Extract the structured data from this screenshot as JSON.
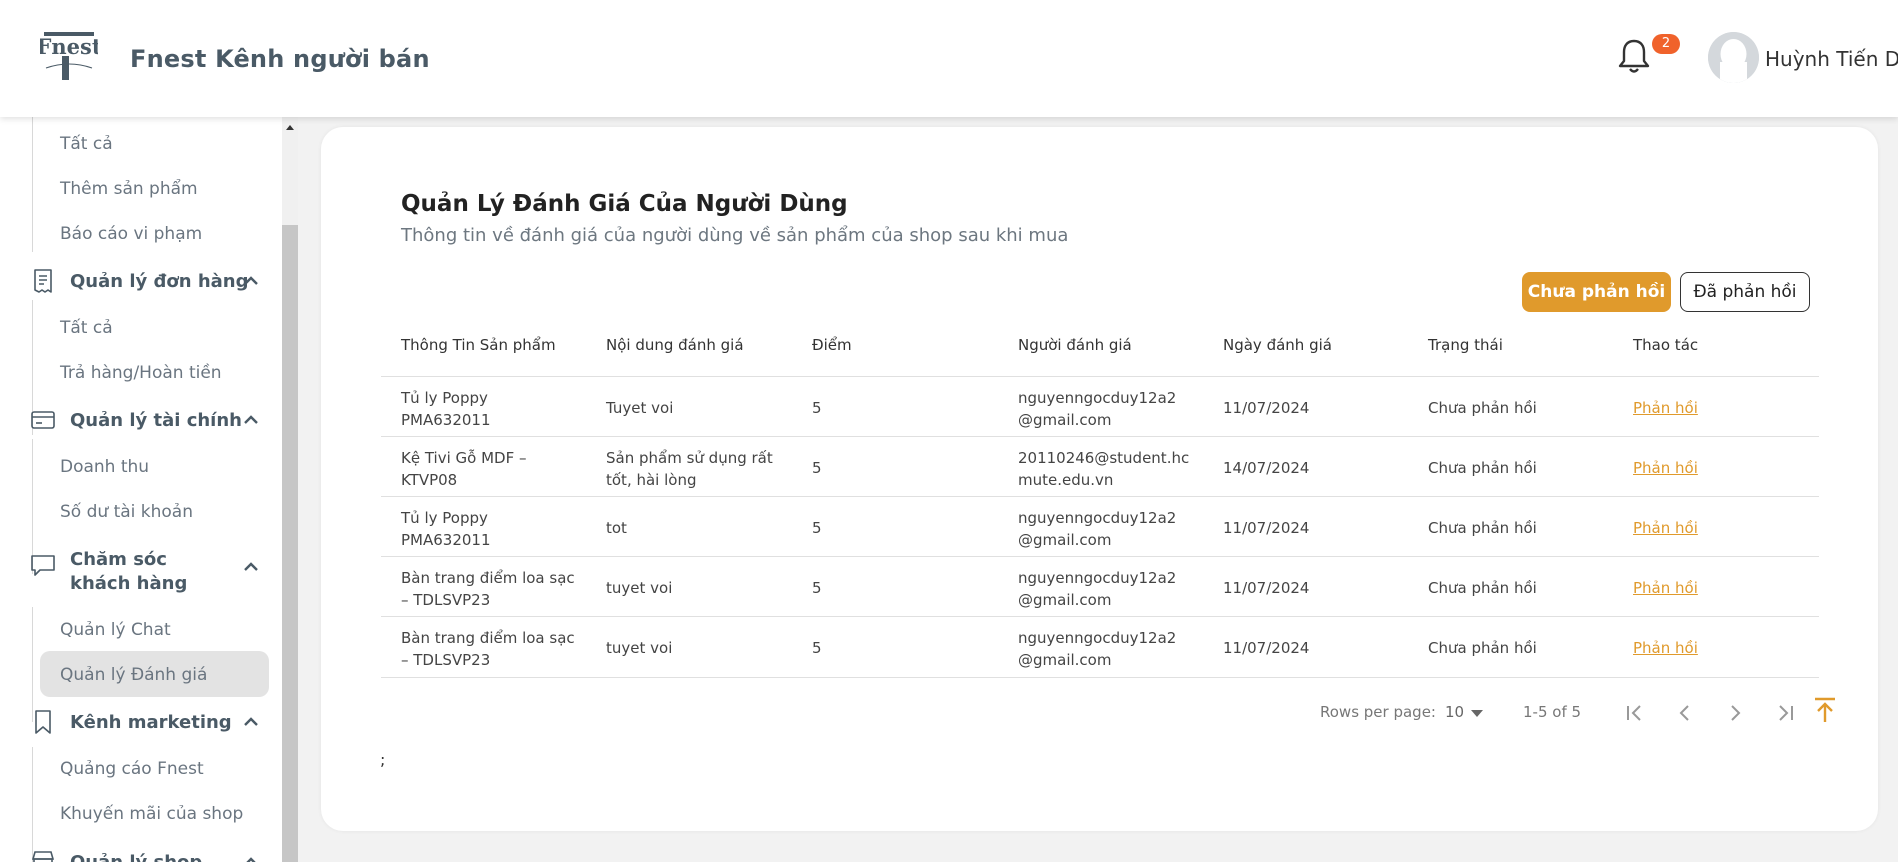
{
  "header": {
    "brand": "Fnest Kênh người bán",
    "logo_text": "Fnest",
    "notification_count": "2",
    "user_name": "Huỳnh Tiến Dĩ"
  },
  "sidebar": {
    "sub_top": [
      "Tất cả",
      "Thêm sản phẩm",
      "Báo cáo vi phạm"
    ],
    "group_orders": "Quản lý đơn hàng",
    "orders_items": [
      "Tất cả",
      "Trả hàng/Hoàn tiền"
    ],
    "group_finance": "Quản lý tài chính",
    "finance_items": [
      "Doanh thu",
      "Số dư tài khoản"
    ],
    "group_cs_line1": "Chăm sóc",
    "group_cs_line2": "khách hàng",
    "cs_items": [
      "Quản lý Chat",
      "Quản lý Đánh giá"
    ],
    "group_marketing": "Kênh marketing",
    "marketing_items": [
      "Quảng cáo Fnest",
      "Khuyến mãi của shop"
    ],
    "group_shop": "Quản lý shop"
  },
  "main": {
    "title": "Quản Lý Đánh Giá Của Người Dùng",
    "subtitle": "Thông tin về đánh giá của người dùng về sản phẩm của shop sau khi mua",
    "btn_pending": "Chưa phản hồi",
    "btn_done": "Đã phản hồi",
    "columns": [
      "Thông Tin Sản phẩm",
      "Nội dung đánh giá",
      "Điểm",
      "Người đánh giá",
      "Ngày đánh giá",
      "Trạng thái",
      "Thao tác"
    ],
    "rows": [
      {
        "product": [
          "Tủ ly Poppy",
          "PMA632011"
        ],
        "content": [
          "Tuyet voi"
        ],
        "score": "5",
        "reviewer": [
          "nguyenngocduy12a2",
          "@gmail.com"
        ],
        "date": "11/07/2024",
        "status": "Chưa phản hồi",
        "action": "Phản hồi"
      },
      {
        "product": [
          "Kệ Tivi Gỗ MDF –",
          "KTVP08"
        ],
        "content": [
          "Sản phẩm sử dụng rất",
          "tốt, hài lòng"
        ],
        "score": "5",
        "reviewer": [
          "20110246@student.hc",
          "mute.edu.vn"
        ],
        "date": "14/07/2024",
        "status": "Chưa phản hồi",
        "action": "Phản hồi"
      },
      {
        "product": [
          "Tủ ly Poppy",
          "PMA632011"
        ],
        "content": [
          "tot"
        ],
        "score": "5",
        "reviewer": [
          "nguyenngocduy12a2",
          "@gmail.com"
        ],
        "date": "11/07/2024",
        "status": "Chưa phản hồi",
        "action": "Phản hồi"
      },
      {
        "product": [
          "Bàn trang điểm loa sạc",
          "– TDLSVP23"
        ],
        "content": [
          "tuyet voi"
        ],
        "score": "5",
        "reviewer": [
          "nguyenngocduy12a2",
          "@gmail.com"
        ],
        "date": "11/07/2024",
        "status": "Chưa phản hồi",
        "action": "Phản hồi"
      },
      {
        "product": [
          "Bàn trang điểm loa sạc",
          "– TDLSVP23"
        ],
        "content": [
          "tuyet voi"
        ],
        "score": "5",
        "reviewer": [
          "nguyenngocduy12a2",
          "@gmail.com"
        ],
        "date": "11/07/2024",
        "status": "Chưa phản hồi",
        "action": "Phản hồi"
      }
    ],
    "pagination": {
      "rows_per_page_label": "Rows per page:",
      "rows_per_page": "10",
      "range": "1-5 of 5"
    },
    "footer_text": ";"
  },
  "colors": {
    "accent": "#e09a2c",
    "badge": "#f0622b",
    "nav_text": "#4a5a66"
  }
}
